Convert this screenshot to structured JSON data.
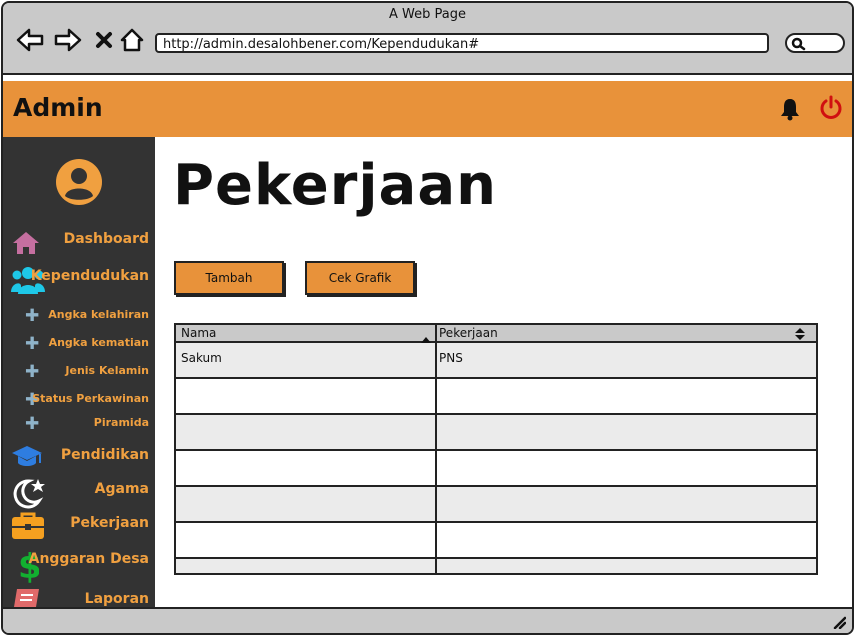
{
  "window": {
    "title": "A Web Page",
    "url": "http://admin.desalohbener.com/Kependudukan#"
  },
  "app": {
    "title": "Admin"
  },
  "sidebar": {
    "items": [
      {
        "label": "Dashboard",
        "icon": "home-icon"
      },
      {
        "label": "Kependudukan",
        "icon": "users-icon"
      },
      {
        "label": "Pendidikan",
        "icon": "graduation-cap-icon"
      },
      {
        "label": "Agama",
        "icon": "moon-star-icon"
      },
      {
        "label": "Pekerjaan",
        "icon": "briefcase-icon"
      },
      {
        "label": "Anggaran Desa",
        "icon": "dollar-icon"
      },
      {
        "label": "Laporan",
        "icon": "book-icon"
      }
    ],
    "subitems": [
      {
        "label": "Angka kelahiran"
      },
      {
        "label": "Angka kematian"
      },
      {
        "label": "Jenis Kelamin"
      },
      {
        "label": "Status Perkawinan"
      },
      {
        "label": "Piramida"
      }
    ]
  },
  "page": {
    "title": "Pekerjaan"
  },
  "buttons": {
    "add": "Tambah",
    "chart": "Cek Grafik"
  },
  "table": {
    "columns": [
      "Nama",
      "Pekerjaan"
    ],
    "rows": [
      {
        "nama": "Sakum",
        "pekerjaan": "PNS"
      }
    ]
  },
  "colors": {
    "accent": "#e8923a",
    "sidebar": "#333333",
    "label": "#f0a040"
  }
}
